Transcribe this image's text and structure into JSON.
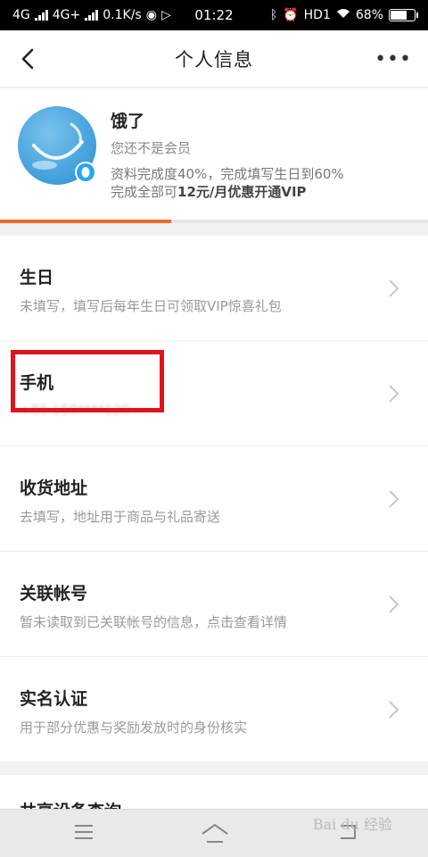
{
  "status_bar": {
    "network1": "4G",
    "network2": "4G+",
    "speed": "0.1K/s",
    "time": "01:22",
    "hd": "HD1",
    "battery": "68%",
    "battery_level": 68
  },
  "navbar": {
    "title": "个人信息",
    "more": "•••"
  },
  "profile": {
    "name": "饿了",
    "vip_status": "您还不是会员",
    "progress_text": "资料完成度40%，完成填写生日到60%",
    "offer_prefix": "完成全部可",
    "offer_bold": "12元/月优惠开通VIP",
    "progress": 40
  },
  "items": [
    {
      "title": "生日",
      "subtitle": "未填写，填写后每年生日可领取VIP惊喜礼包"
    },
    {
      "title": "手机",
      "subtitle": "+86 150****120"
    },
    {
      "title": "收货地址",
      "subtitle": "去填写，地址用于商品与礼品寄送"
    },
    {
      "title": "关联帐号",
      "subtitle": "暂未读取到已关联帐号的信息，点击查看详情"
    },
    {
      "title": "实名认证",
      "subtitle": "用于部分优惠与奖励发放时的身份核实"
    }
  ],
  "next_section": {
    "title": "共享设备查询"
  },
  "watermark": "Bai du 经验"
}
